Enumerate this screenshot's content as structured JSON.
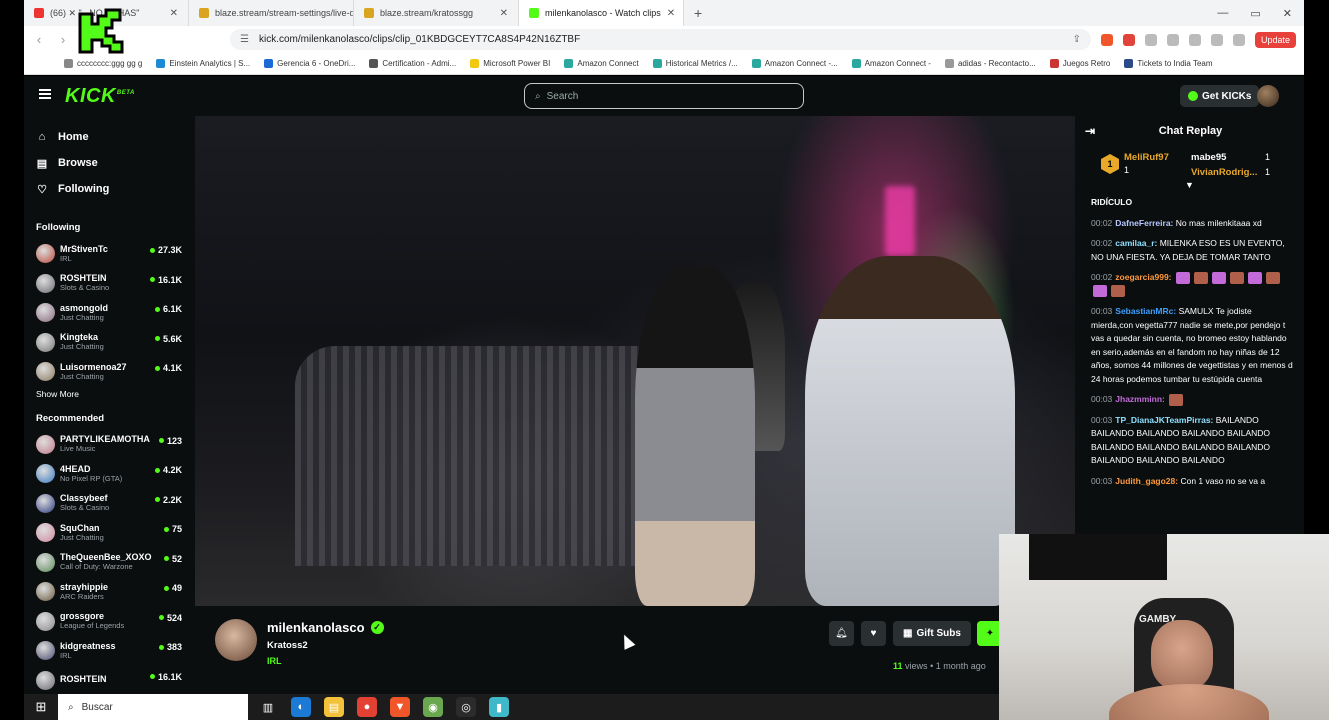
{
  "browser": {
    "tabs": [
      {
        "label": "(66) ✕ \"...NO KCHAS\"",
        "active": false
      },
      {
        "label": "blaze.stream/stream-settings/live-de",
        "active": false
      },
      {
        "label": "blaze.stream/kratossgg",
        "active": false
      },
      {
        "label": "milenkanolasco - Watch clips",
        "active": true
      }
    ],
    "url": "kick.com/milenkanolasco/clips/clip_01KBDGCEYT7CA8S4P42N16ZTBF",
    "update_label": "Update",
    "bookmarks": [
      "cccccccc:ggg gg g",
      "Einstein Analytics | S...",
      "Gerencia 6 - OneDri...",
      "Certification - Admi...",
      "Microsoft Power BI",
      "Amazon Connect",
      "Historical Metrics /...",
      "Amazon Connect -...",
      "Amazon Connect -",
      "adidas - Recontacto...",
      "Juegos Retro",
      "Tickets to India Team"
    ]
  },
  "kick": {
    "logo": "KICK",
    "logo_beta": "BETA",
    "search_placeholder": "Search",
    "get_kicks": "Get KICKs"
  },
  "sidebar": {
    "nav": [
      {
        "label": "Home",
        "icon": "home-icon"
      },
      {
        "label": "Browse",
        "icon": "browse-icon"
      },
      {
        "label": "Following",
        "icon": "heart-icon"
      }
    ],
    "following_title": "Following",
    "following": [
      {
        "name": "MrStivenTc",
        "cat": "IRL",
        "viewers": "27.3K",
        "color": "#b84a3a"
      },
      {
        "name": "ROSHTEIN",
        "cat": "Slots & Casino",
        "viewers": "16.1K",
        "color": "#6a6a72"
      },
      {
        "name": "asmongold",
        "cat": "Just Chatting",
        "viewers": "6.1K",
        "color": "#8a6a80"
      },
      {
        "name": "Kingteka",
        "cat": "Just Chatting",
        "viewers": "5.6K",
        "color": "#777"
      },
      {
        "name": "Luisormenoa27",
        "cat": "Just Chatting",
        "viewers": "4.1K",
        "color": "#8a7a60"
      }
    ],
    "show_more": "Show More",
    "recommended_title": "Recommended",
    "recommended": [
      {
        "name": "PARTYLIKEAMOTHA",
        "cat": "Live Music",
        "viewers": "123",
        "color": "#c07a8a"
      },
      {
        "name": "4HEAD",
        "cat": "No Pixel RP (GTA)",
        "viewers": "4.2K",
        "color": "#3a7ac0"
      },
      {
        "name": "Classybeef",
        "cat": "Slots & Casino",
        "viewers": "2.2K",
        "color": "#2a3a80"
      },
      {
        "name": "SquChan",
        "cat": "Just Chatting",
        "viewers": "75",
        "color": "#d08aa0"
      },
      {
        "name": "TheQueenBee_XOXO",
        "cat": "Call of Duty: Warzone",
        "viewers": "52",
        "color": "#5a8a5a"
      },
      {
        "name": "strayhippie",
        "cat": "ARC Raiders",
        "viewers": "49",
        "color": "#6a5a40"
      },
      {
        "name": "grossgore",
        "cat": "League of Legends",
        "viewers": "524",
        "color": "#8a8a90"
      },
      {
        "name": "kidgreatness",
        "cat": "IRL",
        "viewers": "383",
        "color": "#4a4a70"
      },
      {
        "name": "ROSHTEIN",
        "cat": "",
        "viewers": "16.1K",
        "color": "#6a6a72"
      }
    ]
  },
  "clip": {
    "channel": "milenkanolasco",
    "title": "Kratoss2",
    "category": "IRL",
    "views_count": "11",
    "views_label": "views",
    "age": "• 1 month ago",
    "gift_subs": "Gift Subs"
  },
  "chat": {
    "title": "Chat Replay",
    "gifters": [
      {
        "name": "MeliRuf97",
        "count": "1",
        "rank": "1",
        "color": "#e8a92b"
      },
      {
        "name": "mabe95",
        "count": "1",
        "color": "#ffffff"
      },
      {
        "name": "VivianRodrig...",
        "count": "1",
        "color": "#e8a92b"
      }
    ],
    "messages": [
      {
        "time": "",
        "user": "",
        "user_color": "#fff",
        "text": "RIDÍCULO",
        "emotes": []
      },
      {
        "time": "00:02",
        "user": "DafneFerreira:",
        "user_color": "#b7c7ff",
        "text": "No mas milenkitaaa xd",
        "emotes": []
      },
      {
        "time": "00:02",
        "user": "camilaa_r:",
        "user_color": "#8fe0ff",
        "text": "MILENKA ESO ES UN EVENTO, NO UNA FIESTA. YA DEJA DE TOMAR TANTO",
        "emotes": []
      },
      {
        "time": "00:02",
        "user": "zoegarcia999:",
        "user_color": "#ff9a3c",
        "text": "",
        "emotes": [
          "e-pink",
          "e-face",
          "e-pink",
          "e-face",
          "e-pink",
          "e-face",
          "e-pink",
          "e-face"
        ]
      },
      {
        "time": "00:03",
        "user": "SebastianMRc:",
        "user_color": "#3da0ff",
        "text": "SAMULX Te jodiste mierda,con vegetta777 nadie se mete,por pendejo t vas a quedar sin cuenta, no bromeo estoy hablando en serio,además en el fandom no hay niñas de 12 años, somos 44 millones de vegettistas y en menos d 24 horas podemos tumbar tu estúpida cuenta",
        "emotes": []
      },
      {
        "time": "00:03",
        "user": "Jhazmminn:",
        "user_color": "#c36ad9",
        "text": "",
        "emotes": [
          "e-face"
        ]
      },
      {
        "time": "00:03",
        "user": "TP_DianaJKTeamPirras:",
        "user_color": "#8fe0ff",
        "text": "BAILANDO BAILANDO BAILANDO BAILANDO BAILANDO BAILANDO BAILANDO BAILANDO BAILANDO BAILANDO BAILANDO BAILANDO",
        "emotes": []
      },
      {
        "time": "00:03",
        "user": "Judith_gago28:",
        "user_color": "#ff9a3c",
        "text": "Con 1 vaso no se va a",
        "emotes": []
      }
    ]
  },
  "webcam": {
    "chair_label": "GAMBY"
  },
  "taskbar": {
    "search_placeholder": "Buscar",
    "apps": [
      {
        "icon": "task-view-icon",
        "color": "#1c1c1c",
        "glyph": "▥"
      },
      {
        "icon": "edge-icon",
        "color": "#1b7bd4",
        "glyph": "◐"
      },
      {
        "icon": "file-explorer-icon",
        "color": "#f3c13a",
        "glyph": "▤"
      },
      {
        "icon": "chrome-icon",
        "color": "#e34133",
        "glyph": "●"
      },
      {
        "icon": "brave-icon",
        "color": "#f1562b",
        "glyph": "▼"
      },
      {
        "icon": "globe-icon",
        "color": "#6aa84f",
        "glyph": "◉"
      },
      {
        "icon": "obs-icon",
        "color": "#2b2b2b",
        "glyph": "◎"
      },
      {
        "icon": "app-icon",
        "color": "#3fb8c9",
        "glyph": "▮"
      }
    ]
  }
}
